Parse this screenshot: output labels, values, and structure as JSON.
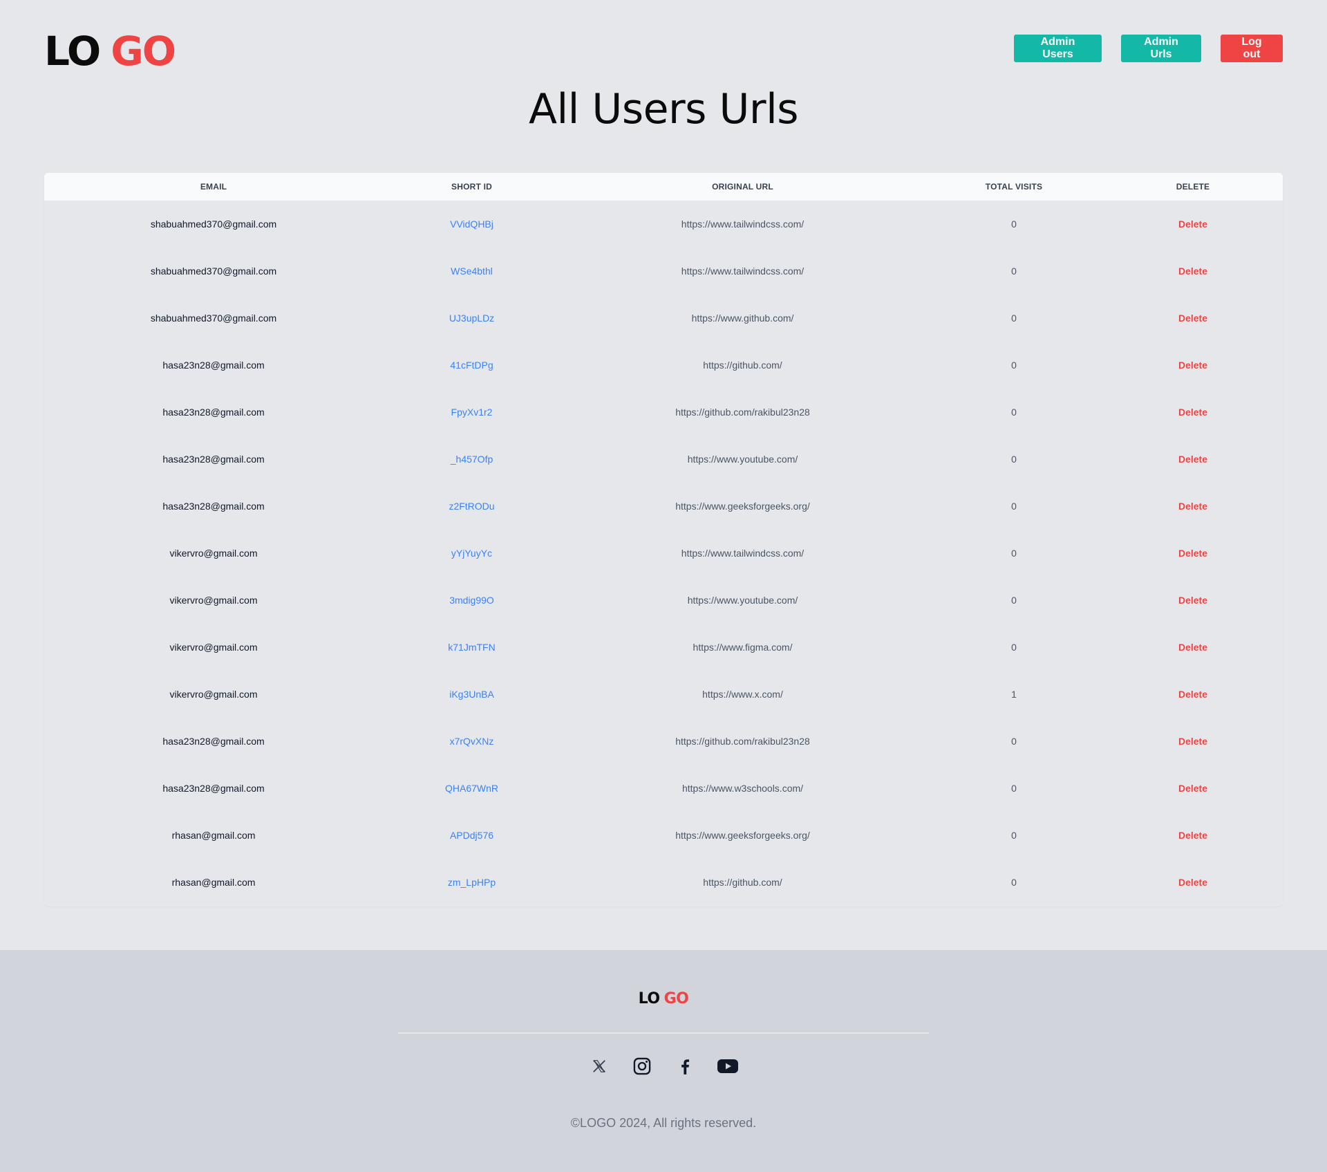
{
  "brand": {
    "logo_part1": "LO",
    "logo_part2": "GO"
  },
  "nav": {
    "admin_users": "Admin Users",
    "admin_urls": "Admin Urls",
    "logout": "Log out"
  },
  "page": {
    "title": "All Users Urls"
  },
  "table": {
    "columns": [
      "EMAIL",
      "SHORT ID",
      "ORIGINAL URL",
      "TOTAL VISITS",
      "DELETE"
    ],
    "rows": [
      {
        "email": "shabuahmed370@gmail.com",
        "short_id": "VVidQHBj",
        "url": "https://www.tailwindcss.com/",
        "visits": "0",
        "action": "Delete"
      },
      {
        "email": "shabuahmed370@gmail.com",
        "short_id": "WSe4bthl",
        "url": "https://www.tailwindcss.com/",
        "visits": "0",
        "action": "Delete"
      },
      {
        "email": "shabuahmed370@gmail.com",
        "short_id": "UJ3upLDz",
        "url": "https://www.github.com/",
        "visits": "0",
        "action": "Delete"
      },
      {
        "email": "hasa23n28@gmail.com",
        "short_id": "41cFtDPg",
        "url": "https://github.com/",
        "visits": "0",
        "action": "Delete"
      },
      {
        "email": "hasa23n28@gmail.com",
        "short_id": "FpyXv1r2",
        "url": "https://github.com/rakibul23n28",
        "visits": "0",
        "action": "Delete"
      },
      {
        "email": "hasa23n28@gmail.com",
        "short_id": "_h457Ofp",
        "url": "https://www.youtube.com/",
        "visits": "0",
        "action": "Delete"
      },
      {
        "email": "hasa23n28@gmail.com",
        "short_id": "z2FtRODu",
        "url": "https://www.geeksforgeeks.org/",
        "visits": "0",
        "action": "Delete"
      },
      {
        "email": "vikervro@gmail.com",
        "short_id": "yYjYuyYc",
        "url": "https://www.tailwindcss.com/",
        "visits": "0",
        "action": "Delete"
      },
      {
        "email": "vikervro@gmail.com",
        "short_id": "3mdig99O",
        "url": "https://www.youtube.com/",
        "visits": "0",
        "action": "Delete"
      },
      {
        "email": "vikervro@gmail.com",
        "short_id": "k71JmTFN",
        "url": "https://www.figma.com/",
        "visits": "0",
        "action": "Delete"
      },
      {
        "email": "vikervro@gmail.com",
        "short_id": "iKg3UnBA",
        "url": "https://www.x.com/",
        "visits": "1",
        "action": "Delete"
      },
      {
        "email": "hasa23n28@gmail.com",
        "short_id": "x7rQvXNz",
        "url": "https://github.com/rakibul23n28",
        "visits": "0",
        "action": "Delete"
      },
      {
        "email": "hasa23n28@gmail.com",
        "short_id": "QHA67WnR",
        "url": "https://www.w3schools.com/",
        "visits": "0",
        "action": "Delete"
      },
      {
        "email": "rhasan@gmail.com",
        "short_id": "APDdj576",
        "url": "https://www.geeksforgeeks.org/",
        "visits": "0",
        "action": "Delete"
      },
      {
        "email": "rhasan@gmail.com",
        "short_id": "zm_LpHPp",
        "url": "https://github.com/",
        "visits": "0",
        "action": "Delete"
      }
    ]
  },
  "footer": {
    "logo_part1": "LO",
    "logo_part2": "GO",
    "social_icons": [
      "x-icon",
      "instagram-icon",
      "facebook-icon",
      "youtube-icon"
    ],
    "copyright": "©LOGO 2024, All rights reserved."
  },
  "colors": {
    "background": "#e5e7eb",
    "accent_teal": "#14b8a6",
    "accent_red": "#ef4444",
    "link_blue": "#3b82f6",
    "footer_bg": "#d1d5db"
  }
}
